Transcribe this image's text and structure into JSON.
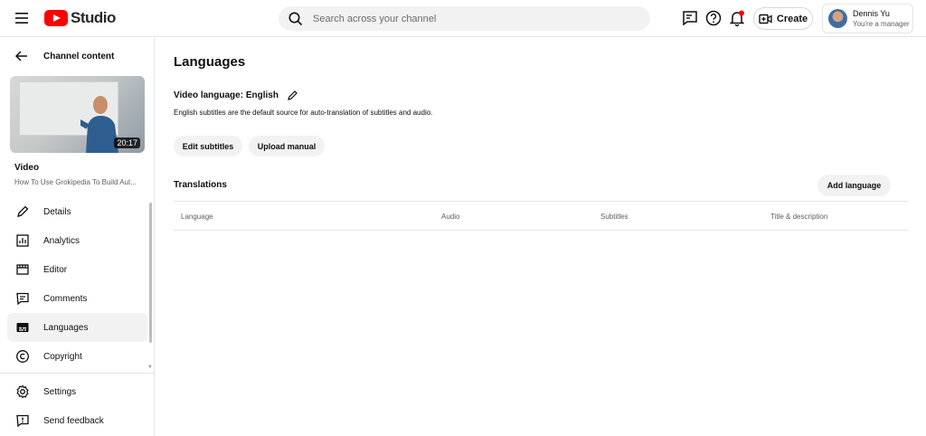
{
  "header": {
    "logo_text": "Studio",
    "search_placeholder": "Search across your channel",
    "create_label": "Create",
    "account": {
      "name": "Dennis Yu",
      "role": "You're a manager"
    },
    "brand_color": "#ff0000"
  },
  "sidebar": {
    "back_label": "Channel content",
    "thumbnail_duration": "20:17",
    "video_label": "Video",
    "video_title": "How To Use Grokipedia To Build Aut...",
    "items": [
      {
        "label": "Details",
        "icon": "pencil-icon"
      },
      {
        "label": "Analytics",
        "icon": "analytics-icon"
      },
      {
        "label": "Editor",
        "icon": "editor-icon"
      },
      {
        "label": "Comments",
        "icon": "comments-icon"
      },
      {
        "label": "Languages",
        "icon": "subtitles-icon",
        "active": true
      },
      {
        "label": "Copyright",
        "icon": "copyright-icon"
      }
    ],
    "bottom_items": [
      {
        "label": "Settings",
        "icon": "gear-icon"
      },
      {
        "label": "Send feedback",
        "icon": "feedback-icon"
      }
    ]
  },
  "main": {
    "title": "Languages",
    "video_language": "Video language: English",
    "description": "English subtitles are the default source for auto-translation of subtitles and audio.",
    "buttons": {
      "edit_subtitles": "Edit subtitles",
      "upload_manual": "Upload manual"
    },
    "translations_label": "Translations",
    "add_language_label": "Add language",
    "table_headers": [
      "Language",
      "Audio",
      "Subtitles",
      "Title & description"
    ]
  }
}
